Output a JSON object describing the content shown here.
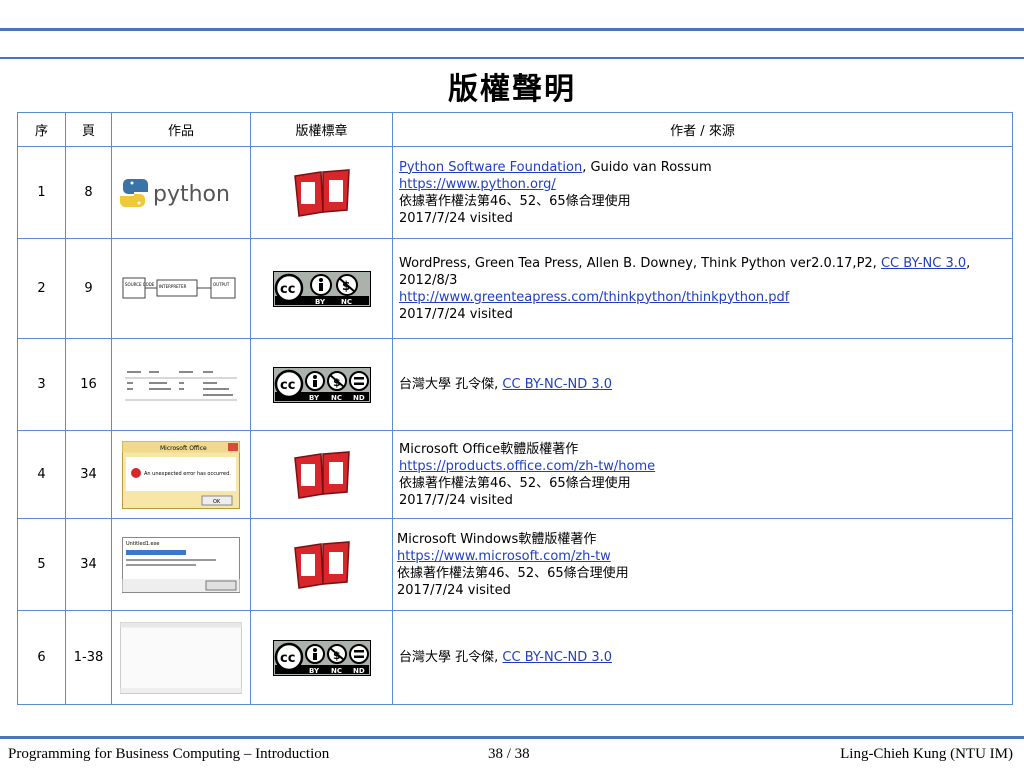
{
  "title": "版權聲明",
  "table": {
    "headers": [
      "序",
      "頁",
      "作品",
      "版權標章",
      "作者 / 來源"
    ],
    "rows": [
      {
        "no": "1",
        "page": "8",
        "work_logo_text": "python",
        "badge": "book",
        "source": [
          {
            "link": "Python Software Foundation",
            "text": ", Guido van Rossum"
          },
          {
            "link": "https://www.python.org/"
          },
          {
            "text": "依據著作權法第46、52、65條合理使用"
          },
          {
            "text": "2017/7/24 visited"
          }
        ]
      },
      {
        "no": "2",
        "page": "9",
        "work_diagram": [
          "SOURCE CODE",
          "INTERPRETER",
          "OUTPUT"
        ],
        "badge": "cc",
        "badge_labels": [
          "BY",
          "NC"
        ],
        "source": [
          {
            "text": "WordPress, Green Tea Press, Allen B. Downey, Think Python ver2.0.17,P2, ",
            "link": "CC BY-NC 3.0",
            "text2": ","
          },
          {
            "text": "2012/8/3"
          },
          {
            "link": "http://www.greenteapress.com/thinkpython/thinkpython.pdf"
          },
          {
            "text": "2017/7/24 visited"
          }
        ]
      },
      {
        "no": "3",
        "page": "16",
        "work_table": "escape-sequences",
        "badge": "cc",
        "badge_labels": [
          "BY",
          "NC",
          "ND"
        ],
        "source": [
          {
            "text": "台灣大學 孔令傑, ",
            "link": "CC BY-NC-ND 3.0"
          }
        ]
      },
      {
        "no": "4",
        "page": "34",
        "work_dialog_title": "Microsoft Office",
        "work_dialog_msg": "An unexpected error has occurred.",
        "work_dialog_btn": "OK",
        "badge": "book",
        "source": [
          {
            "text": "Microsoft Office軟體版權著作"
          },
          {
            "link": "https://products.office.com/zh-tw/home"
          },
          {
            "text": "依據著作權法第46、52、65條合理使用"
          },
          {
            "text": "2017/7/24 visited"
          }
        ]
      },
      {
        "no": "5",
        "page": "34",
        "work_win_title": "Untitled1.exe",
        "badge": "book",
        "source": [
          {
            "text": "Microsoft Windows軟體版權著作"
          },
          {
            "link": "https://www.microsoft.com/zh-tw"
          },
          {
            "text": "依據著作權法第46、52、65條合理使用"
          },
          {
            "text": "2017/7/24 visited"
          }
        ]
      },
      {
        "no": "6",
        "page": "1-38",
        "work_blank": "editor-screenshot",
        "badge": "cc",
        "badge_labels": [
          "BY",
          "NC",
          "ND"
        ],
        "source": [
          {
            "text": "台灣大學 孔令傑, ",
            "link": "CC BY-NC-ND 3.0"
          }
        ]
      }
    ]
  },
  "footer": {
    "left": "Programming for Business Computing – Introduction",
    "page": "38 / 38",
    "right": "Ling-Chieh Kung (NTU IM)"
  },
  "colors": {
    "rule": "#4a76b5",
    "link": "#1f3fbf",
    "book_red": "#d8262b",
    "table_border": "#5b8cd0"
  }
}
